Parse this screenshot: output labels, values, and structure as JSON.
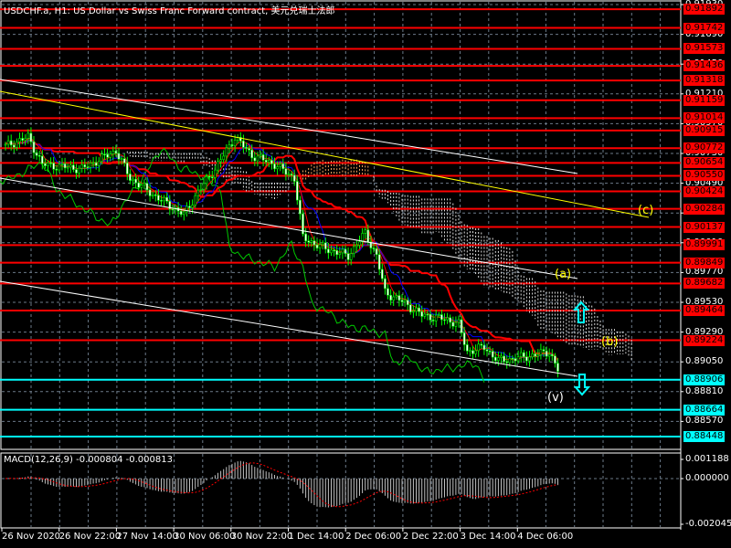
{
  "header": {
    "title": "USDCHF.a, H1:  US Dollar vs Swiss Franc Forward contract, 美元兑瑞士法郎"
  },
  "price_axis": {
    "grid_labels": [
      "0.91930",
      "0.91690",
      "0.91450",
      "0.91210",
      "0.90970",
      "0.90730",
      "0.90490",
      "0.90250",
      "0.90010",
      "0.89770",
      "0.89530",
      "0.89290",
      "0.89050",
      "0.88810",
      "0.88570"
    ],
    "red_levels": [
      "0.91892",
      "0.91742",
      "0.91573",
      "0.91436",
      "0.91318",
      "0.91159",
      "0.91014",
      "0.90915",
      "0.90772",
      "0.90654",
      "0.90550",
      "0.90424",
      "0.90284",
      "0.90137",
      "0.89991",
      "0.89849",
      "0.89682",
      "0.89464",
      "0.89224"
    ],
    "cyan_levels": [
      "0.88906",
      "0.88664",
      "0.88448"
    ]
  },
  "time_axis": [
    "26 Nov 2020",
    "26 Nov 22:00",
    "27 Nov 14:00",
    "30 Nov 06:00",
    "30 Nov 22:00",
    "1 Dec 14:00",
    "2 Dec 06:00",
    "2 Dec 22:00",
    "3 Dec 14:00",
    "4 Dec 06:00"
  ],
  "wave_labels": {
    "c": "(c)",
    "a": "(a)",
    "b": "(b)",
    "v": "(v)"
  },
  "macd": {
    "label": "MACD(12,26,9) -0.000804 -0.000813",
    "axis_labels": [
      "0.001188",
      "0.000000",
      "-0.002045"
    ]
  },
  "colors": {
    "red_level": "#ff0000",
    "cyan_level": "#00ffff",
    "bull": "#00ff00",
    "bear": "#ffffff",
    "trend": "#ffffff",
    "trend_yellow": "#ffff00"
  },
  "chart_data": {
    "type": "candlestick",
    "symbol": "USDCHF.a",
    "timeframe": "H1",
    "price_range": [
      0.8835,
      0.9196
    ],
    "close_keypoints": [
      [
        0,
        0.90789
      ],
      [
        8,
        0.90862
      ],
      [
        13,
        0.90642
      ],
      [
        27,
        0.90605
      ],
      [
        39,
        0.90752
      ],
      [
        44,
        0.90531
      ],
      [
        53,
        0.90384
      ],
      [
        63,
        0.90237
      ],
      [
        68,
        0.90421
      ],
      [
        74,
        0.90605
      ],
      [
        81,
        0.90862
      ],
      [
        87,
        0.90715
      ],
      [
        95,
        0.90642
      ],
      [
        102,
        0.90531
      ],
      [
        105,
        0.90053
      ],
      [
        111,
        0.89979
      ],
      [
        121,
        0.89905
      ],
      [
        127,
        0.90089
      ],
      [
        131,
        0.89905
      ],
      [
        134,
        0.89611
      ],
      [
        140,
        0.89537
      ],
      [
        147,
        0.89427
      ],
      [
        156,
        0.8939
      ],
      [
        160,
        0.89353
      ],
      [
        163,
        0.89132
      ],
      [
        169,
        0.89169
      ],
      [
        174,
        0.89059
      ],
      [
        185,
        0.89096
      ],
      [
        192,
        0.89132
      ],
      [
        195,
        0.88985
      ]
    ]
  }
}
